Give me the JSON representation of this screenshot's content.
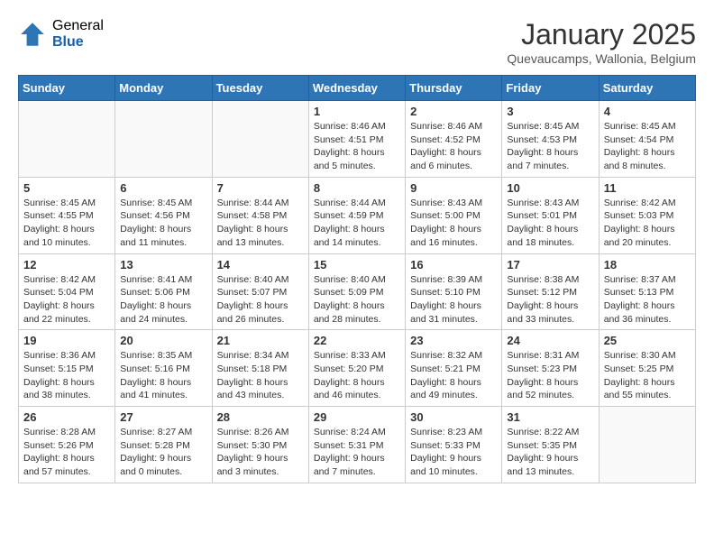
{
  "header": {
    "logo_general": "General",
    "logo_blue": "Blue",
    "month": "January 2025",
    "location": "Quevaucamps, Wallonia, Belgium"
  },
  "weekdays": [
    "Sunday",
    "Monday",
    "Tuesday",
    "Wednesday",
    "Thursday",
    "Friday",
    "Saturday"
  ],
  "weeks": [
    [
      {
        "day": "",
        "info": ""
      },
      {
        "day": "",
        "info": ""
      },
      {
        "day": "",
        "info": ""
      },
      {
        "day": "1",
        "info": "Sunrise: 8:46 AM\nSunset: 4:51 PM\nDaylight: 8 hours\nand 5 minutes."
      },
      {
        "day": "2",
        "info": "Sunrise: 8:46 AM\nSunset: 4:52 PM\nDaylight: 8 hours\nand 6 minutes."
      },
      {
        "day": "3",
        "info": "Sunrise: 8:45 AM\nSunset: 4:53 PM\nDaylight: 8 hours\nand 7 minutes."
      },
      {
        "day": "4",
        "info": "Sunrise: 8:45 AM\nSunset: 4:54 PM\nDaylight: 8 hours\nand 8 minutes."
      }
    ],
    [
      {
        "day": "5",
        "info": "Sunrise: 8:45 AM\nSunset: 4:55 PM\nDaylight: 8 hours\nand 10 minutes."
      },
      {
        "day": "6",
        "info": "Sunrise: 8:45 AM\nSunset: 4:56 PM\nDaylight: 8 hours\nand 11 minutes."
      },
      {
        "day": "7",
        "info": "Sunrise: 8:44 AM\nSunset: 4:58 PM\nDaylight: 8 hours\nand 13 minutes."
      },
      {
        "day": "8",
        "info": "Sunrise: 8:44 AM\nSunset: 4:59 PM\nDaylight: 8 hours\nand 14 minutes."
      },
      {
        "day": "9",
        "info": "Sunrise: 8:43 AM\nSunset: 5:00 PM\nDaylight: 8 hours\nand 16 minutes."
      },
      {
        "day": "10",
        "info": "Sunrise: 8:43 AM\nSunset: 5:01 PM\nDaylight: 8 hours\nand 18 minutes."
      },
      {
        "day": "11",
        "info": "Sunrise: 8:42 AM\nSunset: 5:03 PM\nDaylight: 8 hours\nand 20 minutes."
      }
    ],
    [
      {
        "day": "12",
        "info": "Sunrise: 8:42 AM\nSunset: 5:04 PM\nDaylight: 8 hours\nand 22 minutes."
      },
      {
        "day": "13",
        "info": "Sunrise: 8:41 AM\nSunset: 5:06 PM\nDaylight: 8 hours\nand 24 minutes."
      },
      {
        "day": "14",
        "info": "Sunrise: 8:40 AM\nSunset: 5:07 PM\nDaylight: 8 hours\nand 26 minutes."
      },
      {
        "day": "15",
        "info": "Sunrise: 8:40 AM\nSunset: 5:09 PM\nDaylight: 8 hours\nand 28 minutes."
      },
      {
        "day": "16",
        "info": "Sunrise: 8:39 AM\nSunset: 5:10 PM\nDaylight: 8 hours\nand 31 minutes."
      },
      {
        "day": "17",
        "info": "Sunrise: 8:38 AM\nSunset: 5:12 PM\nDaylight: 8 hours\nand 33 minutes."
      },
      {
        "day": "18",
        "info": "Sunrise: 8:37 AM\nSunset: 5:13 PM\nDaylight: 8 hours\nand 36 minutes."
      }
    ],
    [
      {
        "day": "19",
        "info": "Sunrise: 8:36 AM\nSunset: 5:15 PM\nDaylight: 8 hours\nand 38 minutes."
      },
      {
        "day": "20",
        "info": "Sunrise: 8:35 AM\nSunset: 5:16 PM\nDaylight: 8 hours\nand 41 minutes."
      },
      {
        "day": "21",
        "info": "Sunrise: 8:34 AM\nSunset: 5:18 PM\nDaylight: 8 hours\nand 43 minutes."
      },
      {
        "day": "22",
        "info": "Sunrise: 8:33 AM\nSunset: 5:20 PM\nDaylight: 8 hours\nand 46 minutes."
      },
      {
        "day": "23",
        "info": "Sunrise: 8:32 AM\nSunset: 5:21 PM\nDaylight: 8 hours\nand 49 minutes."
      },
      {
        "day": "24",
        "info": "Sunrise: 8:31 AM\nSunset: 5:23 PM\nDaylight: 8 hours\nand 52 minutes."
      },
      {
        "day": "25",
        "info": "Sunrise: 8:30 AM\nSunset: 5:25 PM\nDaylight: 8 hours\nand 55 minutes."
      }
    ],
    [
      {
        "day": "26",
        "info": "Sunrise: 8:28 AM\nSunset: 5:26 PM\nDaylight: 8 hours\nand 57 minutes."
      },
      {
        "day": "27",
        "info": "Sunrise: 8:27 AM\nSunset: 5:28 PM\nDaylight: 9 hours\nand 0 minutes."
      },
      {
        "day": "28",
        "info": "Sunrise: 8:26 AM\nSunset: 5:30 PM\nDaylight: 9 hours\nand 3 minutes."
      },
      {
        "day": "29",
        "info": "Sunrise: 8:24 AM\nSunset: 5:31 PM\nDaylight: 9 hours\nand 7 minutes."
      },
      {
        "day": "30",
        "info": "Sunrise: 8:23 AM\nSunset: 5:33 PM\nDaylight: 9 hours\nand 10 minutes."
      },
      {
        "day": "31",
        "info": "Sunrise: 8:22 AM\nSunset: 5:35 PM\nDaylight: 9 hours\nand 13 minutes."
      },
      {
        "day": "",
        "info": ""
      }
    ]
  ]
}
